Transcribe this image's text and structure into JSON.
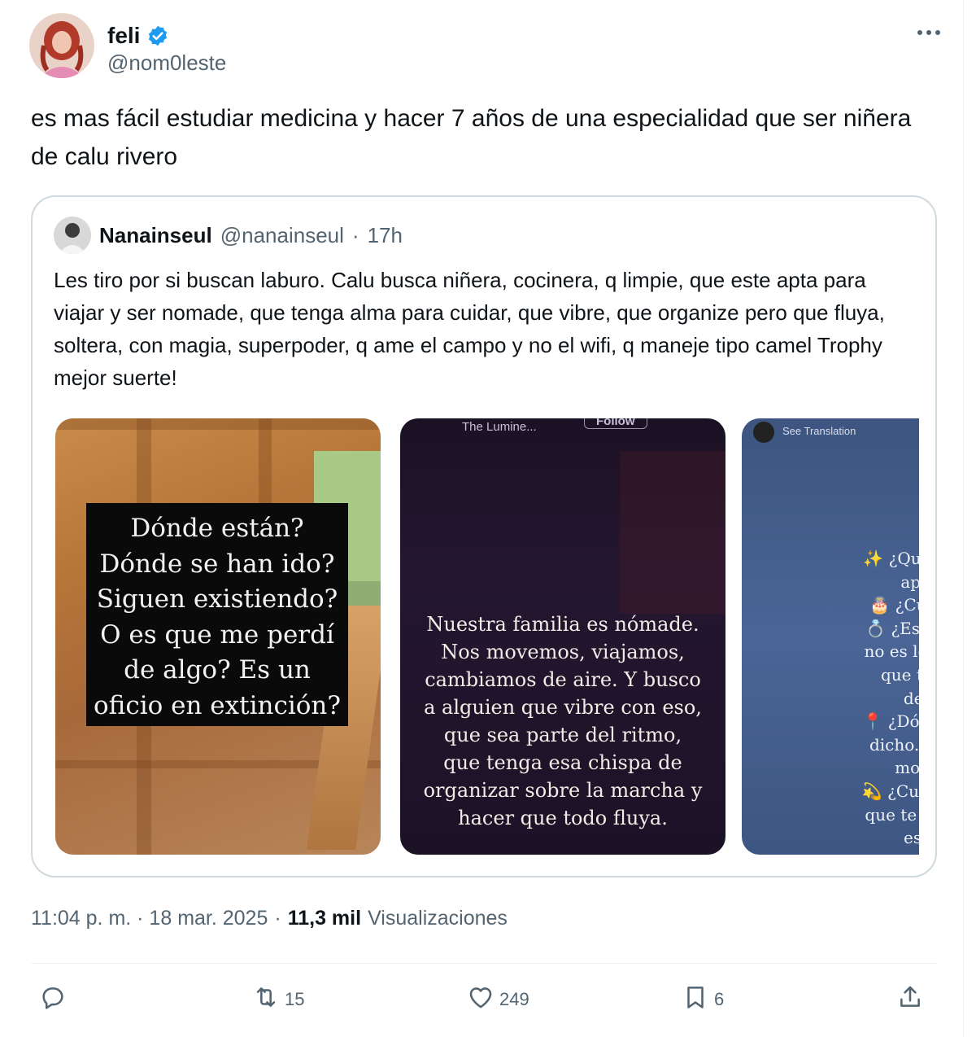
{
  "tweet": {
    "author_name": "feli",
    "author_handle": "@nom0leste",
    "text": "es mas fácil estudiar medicina y hacer 7 años de una especialidad que ser niñera de calu rivero",
    "timestamp": "11:04 p. m. · 18 mar. 2025",
    "meta_sep": "·",
    "views_count": "11,3 mil",
    "views_label": "Visualizaciones"
  },
  "quote": {
    "author_name": "Nanainseul",
    "author_handle": "@nanainseul",
    "separator": "·",
    "time": "17h",
    "text": "Les tiro por si buscan laburo. Calu busca niñera, cocinera, q limpie, que este apta para viajar y ser nomade, que tenga alma para cuidar, que vibre, que organize pero que fluya, soltera, con magia, superpoder, q ame el campo y no el wifi, q maneje tipo camel Trophy mejor suerte!",
    "images": [
      {
        "icon": "photo-wood-cabin",
        "caption": "Dónde están? Dónde se han ido? Siguen existiendo? O es que me perdí de algo? Es un oficio en extinción?"
      },
      {
        "icon": "photo-dark-story",
        "top_label": "The Lumine...",
        "top_button": "Follow",
        "caption": "Nuestra familia es nómade. Nos movemos, viajamos, cambiamos de aire. Y busco a alguien que vibre con eso, que sea parte del ritmo, que tenga esa chispa de organizar sobre la marcha y hacer que todo fluya."
      },
      {
        "icon": "photo-blue-story",
        "top_label": "See Translation",
        "caption": "✨ ¿Quién sos\napell\n🎂 ¿Cuántos\n💍 ¿Estado ci\nno es lo mism\nque tener\ndetr\n📍 ¿Dónde viv\ndicho. ¿desd\nmover\n💫 ¿Cuál es tu\nque te hace ú\neste"
      }
    ]
  },
  "actions": {
    "reply_count": "",
    "retweet_count": "15",
    "like_count": "249",
    "bookmark_count": "6"
  },
  "colors": {
    "text_primary": "#0f1419",
    "text_secondary": "#536471",
    "verified_blue": "#1d9bf0",
    "border": "#cfd9de"
  }
}
